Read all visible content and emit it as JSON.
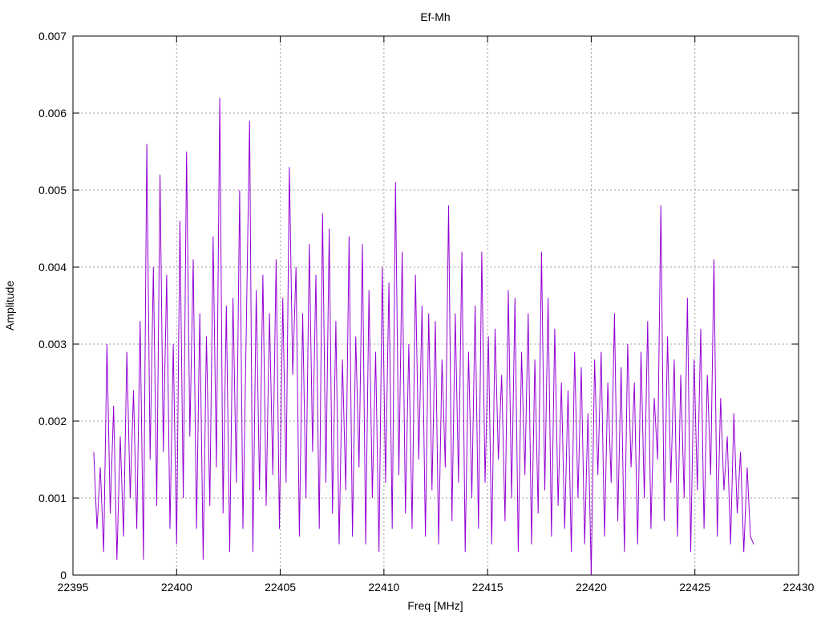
{
  "chart_data": {
    "type": "line",
    "title": "Ef-Mh",
    "xlabel": "Freq [MHz]",
    "ylabel": "Amplitude",
    "xlim": [
      22395,
      22430
    ],
    "ylim": [
      0,
      0.007
    ],
    "xticks": [
      22395,
      22400,
      22405,
      22410,
      22415,
      22420,
      22425,
      22430
    ],
    "xtick_labels": [
      "22395",
      "22400",
      "22405",
      "22410",
      "22415",
      "22420",
      "22425",
      "22430"
    ],
    "yticks": [
      0,
      0.001,
      0.002,
      0.003,
      0.004,
      0.005,
      0.006,
      0.007
    ],
    "ytick_labels": [
      "0",
      "0.001",
      "0.002",
      "0.003",
      "0.004",
      "0.005",
      "0.006",
      "0.007"
    ],
    "grid": true,
    "legend": "none",
    "series": [
      {
        "name": "Ef-Mh",
        "color": "#9400D3",
        "x_start": 22396.0,
        "x_step": 0.16,
        "values": [
          0.0016,
          0.0006,
          0.0014,
          0.0003,
          0.003,
          0.0008,
          0.0022,
          0.0002,
          0.0018,
          0.0005,
          0.0029,
          0.001,
          0.0024,
          0.0006,
          0.0033,
          0.0002,
          0.0056,
          0.0015,
          0.004,
          0.0009,
          0.0052,
          0.0016,
          0.0039,
          0.0006,
          0.003,
          0.0004,
          0.0046,
          0.001,
          0.0055,
          0.0018,
          0.0041,
          0.0006,
          0.0034,
          0.0002,
          0.0031,
          0.0009,
          0.0044,
          0.0014,
          0.0062,
          0.0008,
          0.0035,
          0.0003,
          0.0036,
          0.0012,
          0.005,
          0.0006,
          0.0032,
          0.0059,
          0.0003,
          0.0037,
          0.0011,
          0.0039,
          0.0009,
          0.0034,
          0.0013,
          0.0041,
          0.0006,
          0.0036,
          0.0012,
          0.0053,
          0.0026,
          0.004,
          0.0005,
          0.0034,
          0.001,
          0.0043,
          0.0016,
          0.0039,
          0.0006,
          0.0047,
          0.0012,
          0.0045,
          0.0008,
          0.0033,
          0.0004,
          0.0028,
          0.0011,
          0.0044,
          0.0005,
          0.0031,
          0.0014,
          0.0043,
          0.0004,
          0.0037,
          0.001,
          0.0029,
          0.0003,
          0.004,
          0.0012,
          0.0038,
          0.0006,
          0.0051,
          0.0013,
          0.0042,
          0.0008,
          0.003,
          0.0006,
          0.0039,
          0.0015,
          0.0035,
          0.0005,
          0.0034,
          0.0011,
          0.0033,
          0.0004,
          0.0028,
          0.0014,
          0.0048,
          0.0007,
          0.0034,
          0.0012,
          0.0042,
          0.0003,
          0.0029,
          0.001,
          0.0035,
          0.0006,
          0.0042,
          0.0012,
          0.0031,
          0.0004,
          0.0032,
          0.0015,
          0.0026,
          0.0007,
          0.0037,
          0.001,
          0.0036,
          0.0003,
          0.0029,
          0.0013,
          0.0034,
          0.0004,
          0.0028,
          0.0008,
          0.0042,
          0.0011,
          0.0036,
          0.0005,
          0.0032,
          0.0009,
          0.0025,
          0.0006,
          0.0024,
          0.0003,
          0.0029,
          0.001,
          0.0027,
          0.0004,
          0.0021,
          0.0,
          0.0028,
          0.0013,
          0.0029,
          0.0005,
          0.0025,
          0.0012,
          0.0034,
          0.0007,
          0.0027,
          0.0003,
          0.003,
          0.0014,
          0.0025,
          0.0004,
          0.0029,
          0.001,
          0.0033,
          0.0006,
          0.0023,
          0.0015,
          0.0048,
          0.0007,
          0.0031,
          0.0012,
          0.0028,
          0.0005,
          0.0026,
          0.001,
          0.0036,
          0.0003,
          0.0028,
          0.0011,
          0.0032,
          0.0006,
          0.0026,
          0.0013,
          0.0041,
          0.0005,
          0.0023,
          0.0011,
          0.0018,
          0.0004,
          0.0021,
          0.0008,
          0.0016,
          0.0003,
          0.0014,
          0.0005,
          0.0004
        ]
      }
    ]
  }
}
